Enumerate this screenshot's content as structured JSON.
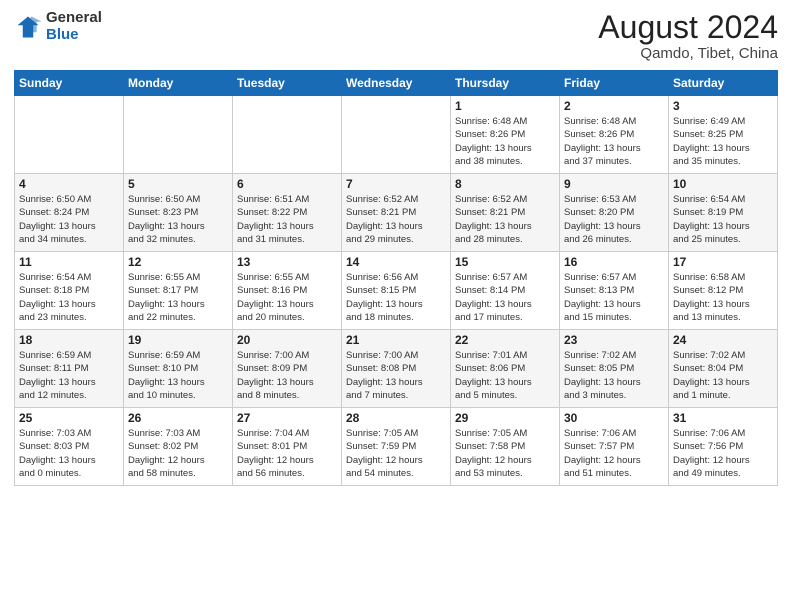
{
  "header": {
    "logo_general": "General",
    "logo_blue": "Blue",
    "month_title": "August 2024",
    "location": "Qamdo, Tibet, China"
  },
  "days_of_week": [
    "Sunday",
    "Monday",
    "Tuesday",
    "Wednesday",
    "Thursday",
    "Friday",
    "Saturday"
  ],
  "weeks": [
    [
      {
        "day": "",
        "info": ""
      },
      {
        "day": "",
        "info": ""
      },
      {
        "day": "",
        "info": ""
      },
      {
        "day": "",
        "info": ""
      },
      {
        "day": "1",
        "info": "Sunrise: 6:48 AM\nSunset: 8:26 PM\nDaylight: 13 hours\nand 38 minutes."
      },
      {
        "day": "2",
        "info": "Sunrise: 6:48 AM\nSunset: 8:26 PM\nDaylight: 13 hours\nand 37 minutes."
      },
      {
        "day": "3",
        "info": "Sunrise: 6:49 AM\nSunset: 8:25 PM\nDaylight: 13 hours\nand 35 minutes."
      }
    ],
    [
      {
        "day": "4",
        "info": "Sunrise: 6:50 AM\nSunset: 8:24 PM\nDaylight: 13 hours\nand 34 minutes."
      },
      {
        "day": "5",
        "info": "Sunrise: 6:50 AM\nSunset: 8:23 PM\nDaylight: 13 hours\nand 32 minutes."
      },
      {
        "day": "6",
        "info": "Sunrise: 6:51 AM\nSunset: 8:22 PM\nDaylight: 13 hours\nand 31 minutes."
      },
      {
        "day": "7",
        "info": "Sunrise: 6:52 AM\nSunset: 8:21 PM\nDaylight: 13 hours\nand 29 minutes."
      },
      {
        "day": "8",
        "info": "Sunrise: 6:52 AM\nSunset: 8:21 PM\nDaylight: 13 hours\nand 28 minutes."
      },
      {
        "day": "9",
        "info": "Sunrise: 6:53 AM\nSunset: 8:20 PM\nDaylight: 13 hours\nand 26 minutes."
      },
      {
        "day": "10",
        "info": "Sunrise: 6:54 AM\nSunset: 8:19 PM\nDaylight: 13 hours\nand 25 minutes."
      }
    ],
    [
      {
        "day": "11",
        "info": "Sunrise: 6:54 AM\nSunset: 8:18 PM\nDaylight: 13 hours\nand 23 minutes."
      },
      {
        "day": "12",
        "info": "Sunrise: 6:55 AM\nSunset: 8:17 PM\nDaylight: 13 hours\nand 22 minutes."
      },
      {
        "day": "13",
        "info": "Sunrise: 6:55 AM\nSunset: 8:16 PM\nDaylight: 13 hours\nand 20 minutes."
      },
      {
        "day": "14",
        "info": "Sunrise: 6:56 AM\nSunset: 8:15 PM\nDaylight: 13 hours\nand 18 minutes."
      },
      {
        "day": "15",
        "info": "Sunrise: 6:57 AM\nSunset: 8:14 PM\nDaylight: 13 hours\nand 17 minutes."
      },
      {
        "day": "16",
        "info": "Sunrise: 6:57 AM\nSunset: 8:13 PM\nDaylight: 13 hours\nand 15 minutes."
      },
      {
        "day": "17",
        "info": "Sunrise: 6:58 AM\nSunset: 8:12 PM\nDaylight: 13 hours\nand 13 minutes."
      }
    ],
    [
      {
        "day": "18",
        "info": "Sunrise: 6:59 AM\nSunset: 8:11 PM\nDaylight: 13 hours\nand 12 minutes."
      },
      {
        "day": "19",
        "info": "Sunrise: 6:59 AM\nSunset: 8:10 PM\nDaylight: 13 hours\nand 10 minutes."
      },
      {
        "day": "20",
        "info": "Sunrise: 7:00 AM\nSunset: 8:09 PM\nDaylight: 13 hours\nand 8 minutes."
      },
      {
        "day": "21",
        "info": "Sunrise: 7:00 AM\nSunset: 8:08 PM\nDaylight: 13 hours\nand 7 minutes."
      },
      {
        "day": "22",
        "info": "Sunrise: 7:01 AM\nSunset: 8:06 PM\nDaylight: 13 hours\nand 5 minutes."
      },
      {
        "day": "23",
        "info": "Sunrise: 7:02 AM\nSunset: 8:05 PM\nDaylight: 13 hours\nand 3 minutes."
      },
      {
        "day": "24",
        "info": "Sunrise: 7:02 AM\nSunset: 8:04 PM\nDaylight: 13 hours\nand 1 minute."
      }
    ],
    [
      {
        "day": "25",
        "info": "Sunrise: 7:03 AM\nSunset: 8:03 PM\nDaylight: 13 hours\nand 0 minutes."
      },
      {
        "day": "26",
        "info": "Sunrise: 7:03 AM\nSunset: 8:02 PM\nDaylight: 12 hours\nand 58 minutes."
      },
      {
        "day": "27",
        "info": "Sunrise: 7:04 AM\nSunset: 8:01 PM\nDaylight: 12 hours\nand 56 minutes."
      },
      {
        "day": "28",
        "info": "Sunrise: 7:05 AM\nSunset: 7:59 PM\nDaylight: 12 hours\nand 54 minutes."
      },
      {
        "day": "29",
        "info": "Sunrise: 7:05 AM\nSunset: 7:58 PM\nDaylight: 12 hours\nand 53 minutes."
      },
      {
        "day": "30",
        "info": "Sunrise: 7:06 AM\nSunset: 7:57 PM\nDaylight: 12 hours\nand 51 minutes."
      },
      {
        "day": "31",
        "info": "Sunrise: 7:06 AM\nSunset: 7:56 PM\nDaylight: 12 hours\nand 49 minutes."
      }
    ]
  ]
}
